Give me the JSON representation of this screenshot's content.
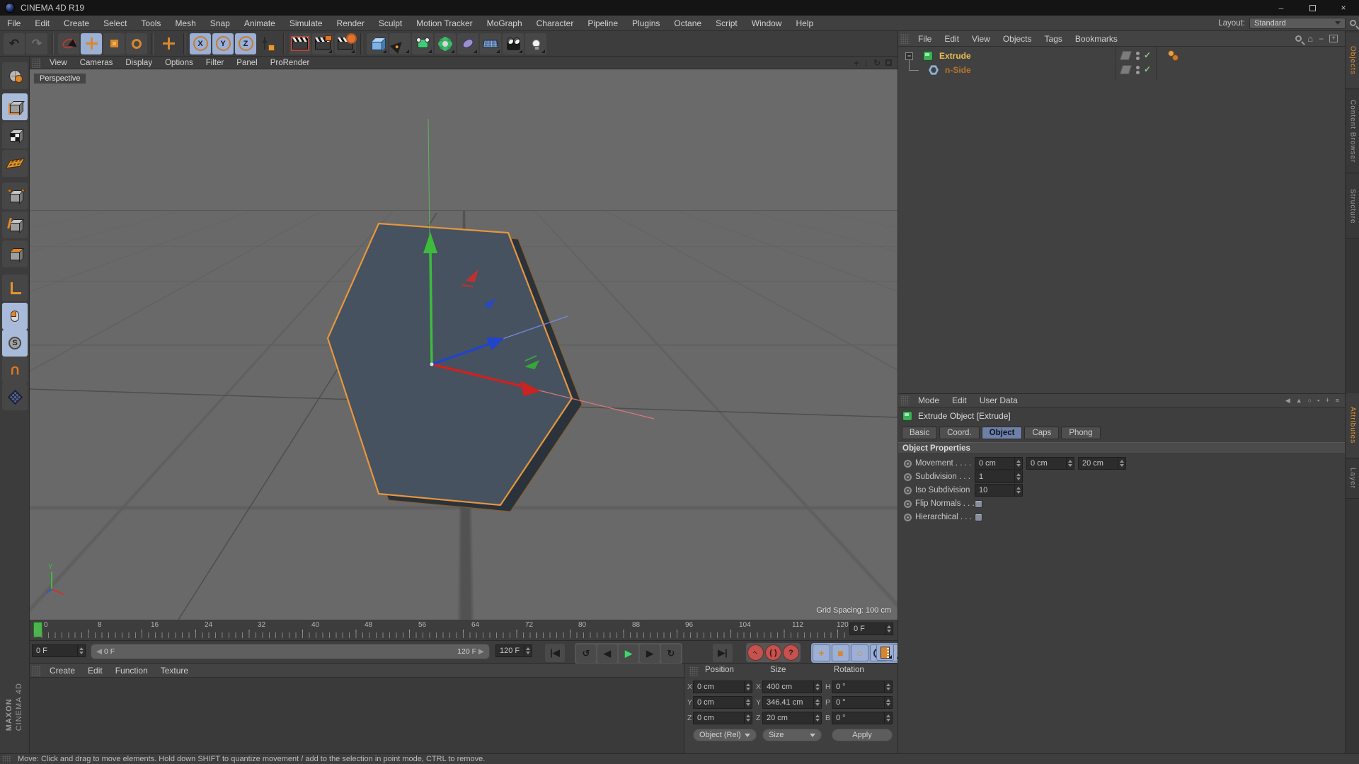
{
  "window": {
    "title": "CINEMA 4D R19"
  },
  "menu_bar": {
    "items": [
      "File",
      "Edit",
      "Create",
      "Select",
      "Tools",
      "Mesh",
      "Snap",
      "Animate",
      "Simulate",
      "Render",
      "Sculpt",
      "Motion Tracker",
      "MoGraph",
      "Character",
      "Pipeline",
      "Plugins",
      "Octane",
      "Script",
      "Window",
      "Help"
    ]
  },
  "layout": {
    "label": "Layout:",
    "value": "Standard"
  },
  "viewport": {
    "menu": [
      "View",
      "Cameras",
      "Display",
      "Options",
      "Filter",
      "Panel",
      "ProRender"
    ],
    "label": "Perspective",
    "grid_spacing": "Grid Spacing: 100 cm",
    "axis_label_y": "Y"
  },
  "object_manager": {
    "menu": [
      "File",
      "Edit",
      "View",
      "Objects",
      "Tags",
      "Bookmarks"
    ],
    "objects": [
      {
        "name": "Extrude"
      },
      {
        "name": "n-Side"
      }
    ],
    "side_tabs": [
      "Objects",
      "Content Browser",
      "Structure"
    ]
  },
  "attributes": {
    "menu": [
      "Mode",
      "Edit",
      "User Data"
    ],
    "title": "Extrude Object [Extrude]",
    "tabs": [
      "Basic",
      "Coord.",
      "Object",
      "Caps",
      "Phong"
    ],
    "active_tab": "Object",
    "section": "Object Properties",
    "rows": [
      {
        "label": "Movement . . . .",
        "values": [
          "0 cm",
          "0 cm",
          "20 cm"
        ]
      },
      {
        "label": "Subdivision . . .",
        "values": [
          "1"
        ]
      },
      {
        "label": "Iso Subdivision",
        "values": [
          "10"
        ]
      },
      {
        "label": "Flip Normals . . .",
        "checkbox": "unchecked"
      },
      {
        "label": "Hierarchical . . .",
        "checkbox": "unchecked"
      }
    ],
    "side_tabs": [
      "Attributes",
      "Layer"
    ]
  },
  "timeline": {
    "ticks": [
      "0",
      "8",
      "16",
      "24",
      "32",
      "40",
      "48",
      "56",
      "64",
      "72",
      "80",
      "88",
      "96",
      "104",
      "112",
      "120"
    ],
    "ruler_field": "0 F",
    "current_frame": "0 F",
    "range_start": "0 F",
    "range_end": "120 F",
    "end_frame": "120 F"
  },
  "material_manager": {
    "menu": [
      "Create",
      "Edit",
      "Function",
      "Texture"
    ]
  },
  "coordinates": {
    "headers": [
      "Position",
      "Size",
      "Rotation"
    ],
    "position": {
      "x_label": "X",
      "y_label": "Y",
      "z_label": "Z",
      "x": "0 cm",
      "y": "0 cm",
      "z": "0 cm"
    },
    "size": {
      "x_label": "X",
      "y_label": "Y",
      "z_label": "Z",
      "x": "400 cm",
      "y": "346.41 cm",
      "z": "20 cm"
    },
    "rotation": {
      "h_label": "H",
      "p_label": "P",
      "b_label": "B",
      "h": "0 °",
      "p": "0 °",
      "b": "0 °"
    },
    "mode_dropdown": "Object (Rel)",
    "size_dropdown": "Size",
    "apply_label": "Apply"
  },
  "status_bar": {
    "text": "Move: Click and drag to move elements. Hold down SHIFT to quantize movement / add to the selection in point mode, CTRL to remove."
  },
  "branding": {
    "maxon": "MAXON",
    "cinema": "CINEMA 4D"
  },
  "colors": {
    "accent_orange": "#e0922e",
    "active_blue": "#9cb0d6",
    "axis_green": "#3dbb3d",
    "axis_red": "#cc2222",
    "axis_blue": "#2244cc",
    "selected_outline": "#e8963c",
    "viewport_gray": "#696969",
    "object_selected_text": "#e8c050"
  }
}
